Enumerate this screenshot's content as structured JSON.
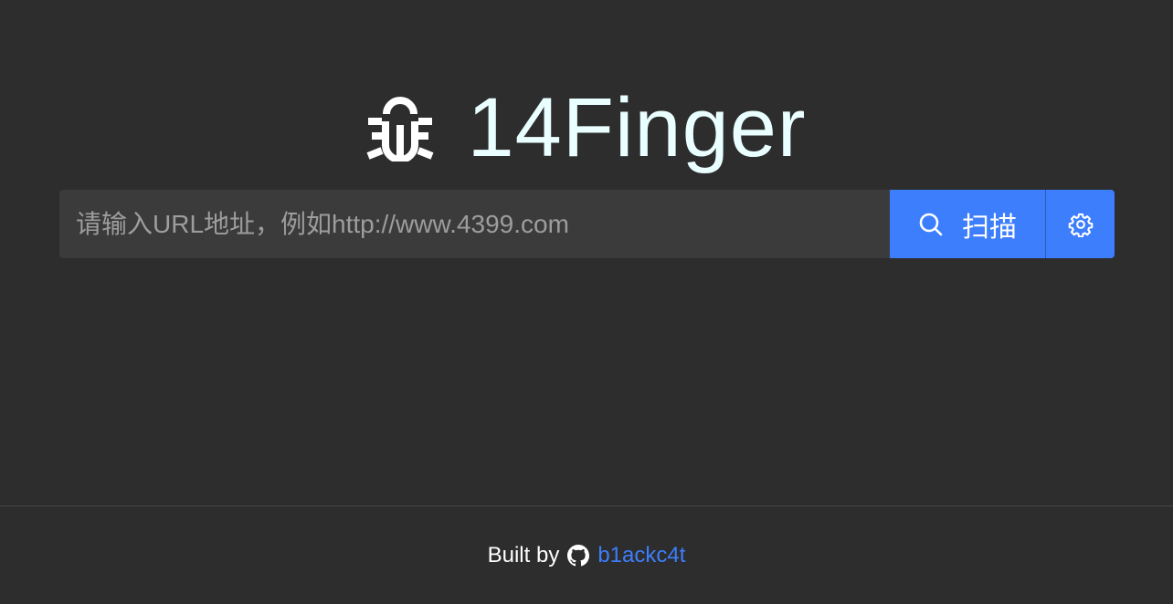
{
  "header": {
    "logo_icon": "bug-icon",
    "title": "14Finger"
  },
  "search": {
    "placeholder": "请输入URL地址，例如http://www.4399.com",
    "value": "",
    "scan_label": "扫描",
    "scan_icon": "search-icon",
    "settings_icon": "gear-icon"
  },
  "footer": {
    "built_by": "Built by",
    "github_icon": "github-icon",
    "author": "b1ackc4t"
  },
  "colors": {
    "background": "#2d2d2d",
    "input_background": "#3b3b3b",
    "accent": "#3d7efc",
    "title": "#eaffff"
  }
}
